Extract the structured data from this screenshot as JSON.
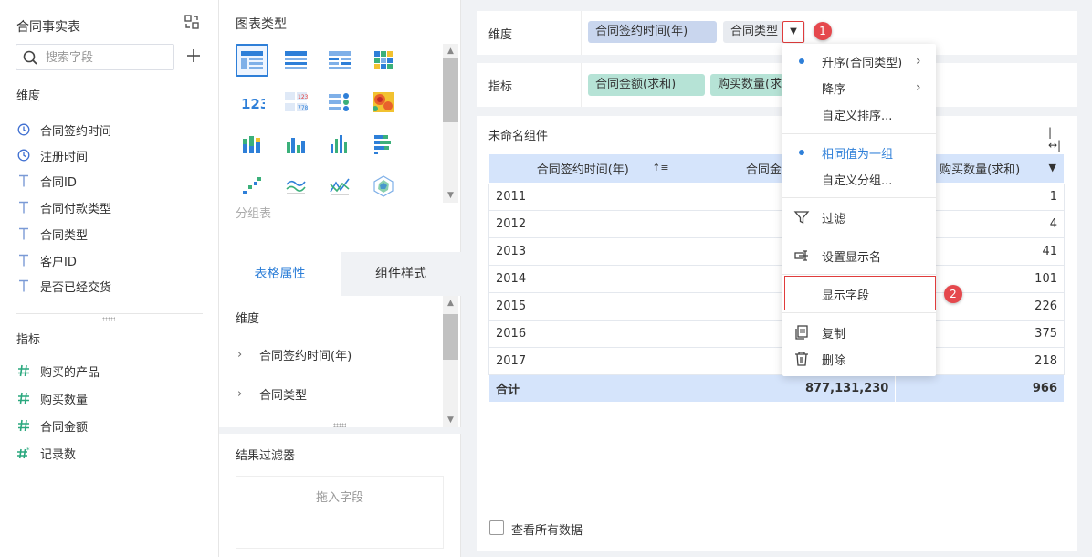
{
  "left": {
    "title": "合同事实表",
    "search_placeholder": "搜索字段",
    "dimension_header": "维度",
    "dimensions": [
      {
        "label": "合同签约时间",
        "icon": "clock-icon"
      },
      {
        "label": "注册时间",
        "icon": "clock-icon"
      },
      {
        "label": "合同ID",
        "icon": "text-type-icon"
      },
      {
        "label": "合同付款类型",
        "icon": "text-type-icon"
      },
      {
        "label": "合同类型",
        "icon": "text-type-icon"
      },
      {
        "label": "客户ID",
        "icon": "text-type-icon"
      },
      {
        "label": "是否已经交货",
        "icon": "text-type-icon"
      }
    ],
    "measure_header": "指标",
    "measures": [
      {
        "label": "购买的产品",
        "icon": "hash-icon"
      },
      {
        "label": "购买数量",
        "icon": "hash-icon"
      },
      {
        "label": "合同金额",
        "icon": "hash-icon"
      },
      {
        "label": "记录数",
        "icon": "hash-star-icon"
      }
    ]
  },
  "middle": {
    "chart_type_header": "图表类型",
    "chart_type_sub": "分组表",
    "tabs": {
      "table_props": "表格属性",
      "widget_style": "组件样式"
    },
    "dimension_header": "维度",
    "tree": [
      "合同签约时间(年)",
      "合同类型"
    ],
    "filter_header": "结果过滤器",
    "filter_drop": "拖入字段"
  },
  "right": {
    "dimension_label": "维度",
    "dimension_pills": [
      "合同签约时间(年)",
      "合同类型"
    ],
    "measure_label": "指标",
    "measure_pills": [
      "合同金额(求和)",
      "购买数量(求和)"
    ],
    "widget_title": "未命名组件",
    "table": {
      "headers": [
        "合同签约时间(年)",
        "合同金额(求和)",
        "购买数量(求和)"
      ],
      "rows": [
        [
          "2011",
          "",
          "1"
        ],
        [
          "2012",
          "",
          "4"
        ],
        [
          "2013",
          "",
          "41"
        ],
        [
          "2014",
          "",
          "101"
        ],
        [
          "2015",
          "",
          "226"
        ],
        [
          "2016",
          "",
          "375"
        ],
        [
          "2017",
          "",
          "218"
        ]
      ],
      "total": [
        "合计",
        "877,131,230",
        "966"
      ]
    },
    "view_all": "查看所有数据"
  },
  "menu": {
    "items": [
      {
        "label": "升序(合同类型)",
        "selected": true,
        "submenu": true
      },
      {
        "label": "降序",
        "selected": false,
        "submenu": true
      },
      {
        "label": "自定义排序...",
        "selected": false
      },
      {
        "label": "相同值为一组",
        "selected": true
      },
      {
        "label": "自定义分组...",
        "selected": false
      },
      {
        "label": "过滤",
        "icon": "filter-icon"
      },
      {
        "label": "设置显示名",
        "icon": "rename-icon"
      },
      {
        "label": "显示字段",
        "icon": ""
      },
      {
        "label": "复制",
        "icon": "copy-icon"
      },
      {
        "label": "删除",
        "icon": "trash-icon"
      }
    ]
  },
  "badges": [
    "1",
    "2"
  ],
  "colors": {
    "accent": "#2e7fd8",
    "highlight": "#e03c3c",
    "dim_pill": "#c9d6ee",
    "measure_pill": "#b6e3d6",
    "header": "#d5e4fb"
  }
}
